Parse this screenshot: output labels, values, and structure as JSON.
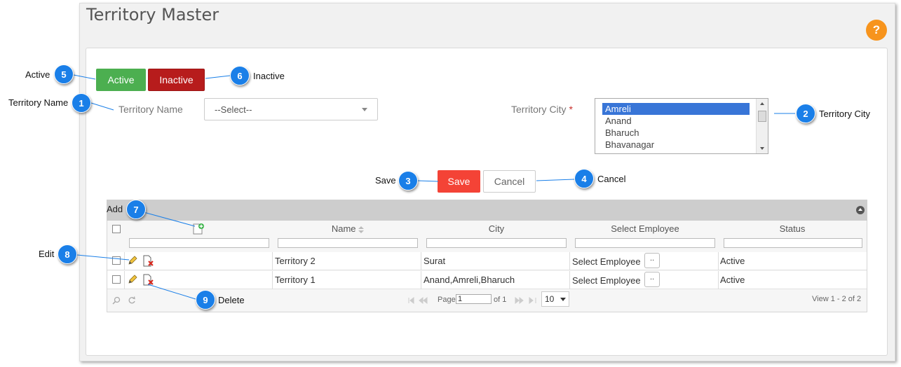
{
  "page": {
    "title": "Territory Master",
    "help_glyph": "?"
  },
  "status_buttons": {
    "active_label": "Active",
    "inactive_label": "Inactive"
  },
  "form": {
    "territory_name_label": "Territory Name",
    "territory_name_value": "--Select--",
    "territory_city_label": "Territory City",
    "required_mark": "*",
    "city_options": [
      "Amreli",
      "Anand",
      "Bharuch",
      "Bhavanagar"
    ],
    "city_selected": "Amreli"
  },
  "actions": {
    "save_label": "Save",
    "cancel_label": "Cancel"
  },
  "grid": {
    "caption": "Add",
    "columns": [
      "Name",
      "City",
      "Select Employee",
      "Status"
    ],
    "rows": [
      {
        "name": "Territory 2",
        "city": "Surat",
        "employee": "Select Employee",
        "status": "Active"
      },
      {
        "name": "Territory 1",
        "city": "Anand,Amreli,Bharuch",
        "employee": "Select Employee",
        "status": "Active"
      }
    ],
    "employee_button_label": "..",
    "pager": {
      "page_label": "Page",
      "page_value": "1",
      "of_label": "of 1",
      "rows_per_page": "10",
      "view_text": "View 1 - 2 of 2"
    }
  },
  "callouts": [
    {
      "num": "1",
      "text": "Territory Name"
    },
    {
      "num": "2",
      "text": "Territory City"
    },
    {
      "num": "3",
      "text": "Save"
    },
    {
      "num": "4",
      "text": "Cancel"
    },
    {
      "num": "5",
      "text": "Active"
    },
    {
      "num": "6",
      "text": "Inactive"
    },
    {
      "num": "7",
      "text": "Add"
    },
    {
      "num": "8",
      "text": "Edit"
    },
    {
      "num": "9",
      "text": "Delete"
    }
  ],
  "colors": {
    "active": "#4caf50",
    "inactive": "#b71c1c",
    "save": "#f44336",
    "callout": "#1a7fe8",
    "help": "#f7941d"
  }
}
